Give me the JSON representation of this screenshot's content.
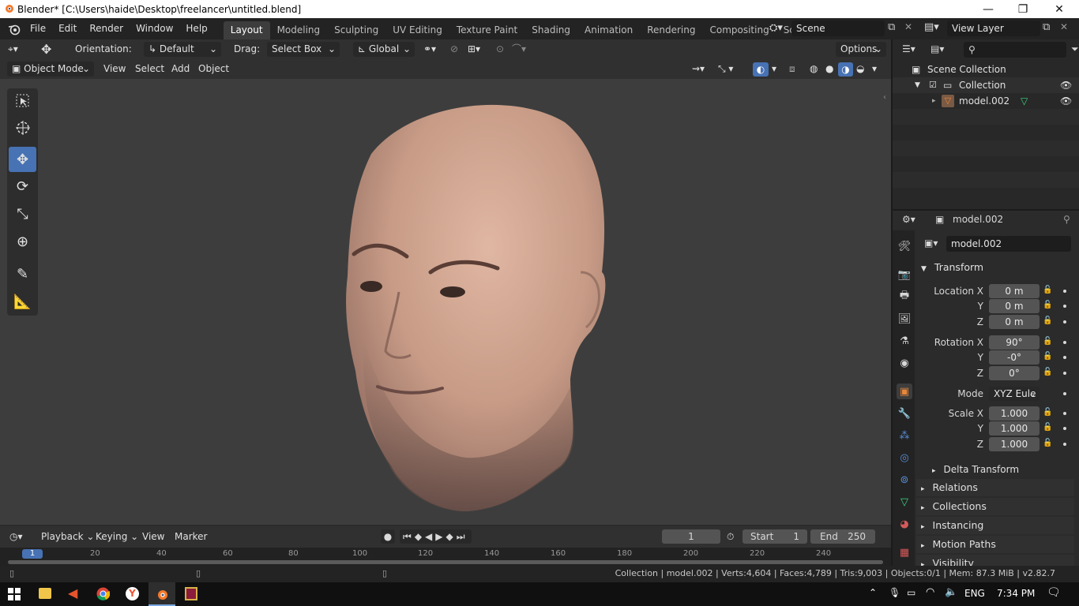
{
  "window": {
    "title": "Blender* [C:\\Users\\haide\\Desktop\\freelancer\\untitled.blend]",
    "minimize": "—",
    "maximize": "❐",
    "close": "✕"
  },
  "menu": [
    "File",
    "Edit",
    "Render",
    "Window",
    "Help"
  ],
  "workspaces": [
    "Layout",
    "Modeling",
    "Sculpting",
    "UV Editing",
    "Texture Paint",
    "Shading",
    "Animation",
    "Rendering",
    "Compositing",
    "Scripting"
  ],
  "workspace_add": "+",
  "scene": {
    "name": "Scene",
    "view_layer": "View Layer"
  },
  "viewport_header": {
    "orientation_label": "Orientation:",
    "orientation_value": "Default",
    "drag_label": "Drag:",
    "drag_value": "Select Box",
    "transform_orientation": "Global",
    "options": "Options"
  },
  "viewport_header2": {
    "mode": "Object Mode",
    "menus": [
      "View",
      "Select",
      "Add",
      "Object"
    ]
  },
  "outliner": {
    "scene_collection": "Scene Collection",
    "collection": "Collection",
    "object": "model.002"
  },
  "properties": {
    "header_object": "model.002",
    "object_name": "model.002",
    "transform_title": "Transform",
    "location_x_label": "Location X",
    "y_label": "Y",
    "z_label": "Z",
    "location": [
      "0 m",
      "0 m",
      "0 m"
    ],
    "rotation_x_label": "Rotation X",
    "rotation": [
      "90°",
      "-0°",
      "0°"
    ],
    "mode_label": "Mode",
    "mode_value": "XYZ Eule",
    "scale_x_label": "Scale X",
    "scale": [
      "1.000",
      "1.000",
      "1.000"
    ],
    "delta_transform": "Delta Transform",
    "panels": [
      "Relations",
      "Collections",
      "Instancing",
      "Motion Paths",
      "Visibility"
    ]
  },
  "timeline": {
    "playback": "Playback",
    "keying": "Keying",
    "view": "View",
    "marker": "Marker",
    "current_frame": "1",
    "start_label": "Start",
    "start_value": "1",
    "end_label": "End",
    "end_value": "250",
    "ruler": [
      "1",
      "20",
      "40",
      "60",
      "80",
      "100",
      "120",
      "140",
      "160",
      "180",
      "200",
      "220",
      "240"
    ]
  },
  "status": {
    "text": "Collection | model.002 | Verts:4,604 | Faces:4,789 | Tris:9,003 | Objects:0/1 | Mem: 87.3 MiB | v2.82.7"
  },
  "taskbar": {
    "language": "ENG",
    "time": "7:34 PM"
  },
  "colors": {
    "accent": "#4772b3",
    "workspace_bg": "#3d3d3d",
    "object_orange": "#e8863a",
    "mesh_green": "#3bd480"
  }
}
